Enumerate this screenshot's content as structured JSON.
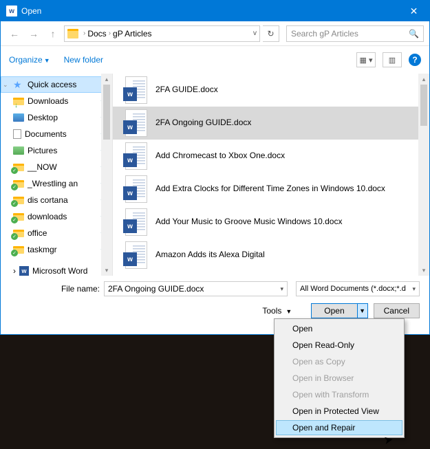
{
  "titlebar": {
    "title": "Open"
  },
  "nav": {
    "crumb1": "Docs",
    "crumb2": "gP Articles",
    "search_placeholder": "Search gP Articles"
  },
  "toolbar": {
    "organize": "Organize",
    "newfolder": "New folder"
  },
  "sidebar": {
    "quick_access": "Quick access",
    "items": [
      {
        "label": "Downloads"
      },
      {
        "label": "Desktop"
      },
      {
        "label": "Documents"
      },
      {
        "label": "Pictures"
      },
      {
        "label": "__NOW"
      },
      {
        "label": "_Wrestling an"
      },
      {
        "label": "dis cortana"
      },
      {
        "label": "downloads"
      },
      {
        "label": "office"
      },
      {
        "label": "taskmgr"
      }
    ],
    "word": "Microsoft Word"
  },
  "files": [
    {
      "name": "2FA GUIDE.docx"
    },
    {
      "name": "2FA Ongoing GUIDE.docx"
    },
    {
      "name": "Add Chromecast to Xbox One.docx"
    },
    {
      "name": "Add Extra Clocks for Different Time Zones in Windows 10.docx"
    },
    {
      "name": "Add Your Music to Groove Music Windows 10.docx"
    },
    {
      "name": "Amazon Adds its Alexa Digital"
    }
  ],
  "footer": {
    "filename_label": "File name:",
    "filename_value": "2FA Ongoing GUIDE.docx",
    "filter": "All Word Documents (*.docx;*.d",
    "tools": "Tools",
    "open": "Open",
    "cancel": "Cancel"
  },
  "menu": {
    "items": [
      {
        "label": "Open",
        "enabled": true
      },
      {
        "label": "Open Read-Only",
        "enabled": true
      },
      {
        "label": "Open as Copy",
        "enabled": false
      },
      {
        "label": "Open in Browser",
        "enabled": false
      },
      {
        "label": "Open with Transform",
        "enabled": false
      },
      {
        "label": "Open in Protected View",
        "enabled": true
      },
      {
        "label": "Open and Repair",
        "enabled": true,
        "hover": true
      }
    ]
  }
}
